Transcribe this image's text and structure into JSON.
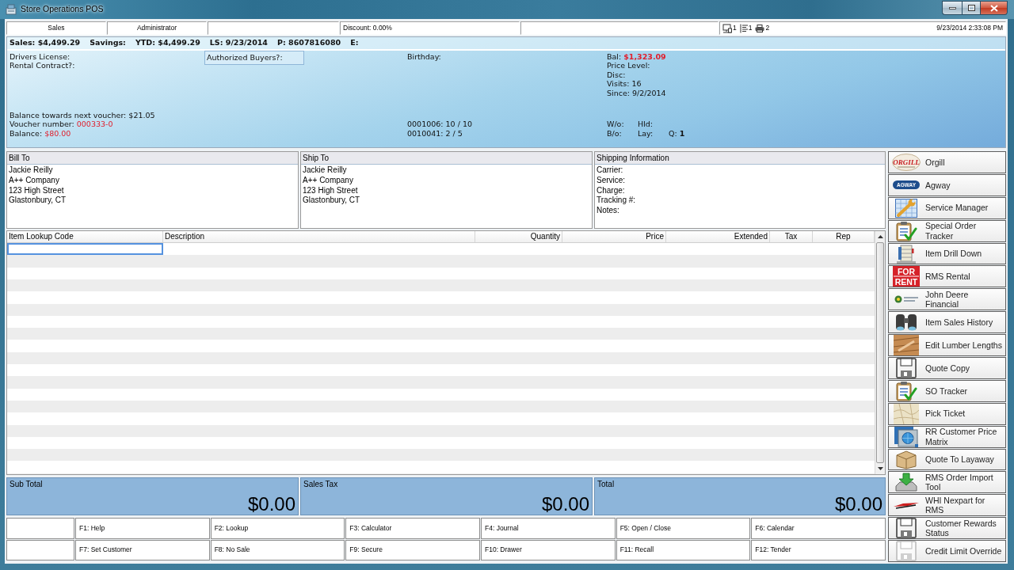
{
  "window": {
    "title": "Store Operations POS"
  },
  "status_strip": {
    "mode": "Sales",
    "user": "Administrator",
    "discount": "Discount: 0.00%",
    "counters": [
      {
        "kind": "register",
        "count": "1"
      },
      {
        "kind": "journal",
        "count": "1"
      },
      {
        "kind": "printer",
        "count": "2"
      }
    ],
    "datetime": "9/23/2014 2:33:08 PM"
  },
  "customer_info": {
    "summary": [
      "Sales: $4,499.29",
      "Savings:",
      "YTD: $4,499.29",
      "LS: 9/23/2014",
      "P: 8607816080",
      "E:"
    ],
    "columns": [
      {
        "framed": false,
        "top": [
          [
            {
              "kind": "plain",
              "label": "Drivers License:"
            }
          ],
          [
            {
              "kind": "plain",
              "label": "Rental Contract?:"
            }
          ]
        ],
        "bottom": [
          [
            {
              "kind": "plain",
              "label": "Balance towards next voucher:",
              "value": "$21.05"
            }
          ],
          [
            {
              "kind": "alert",
              "label": "Voucher number:",
              "value": "000333-0"
            }
          ],
          [
            {
              "kind": "alert",
              "label": "Balance:",
              "value": "$80.00"
            }
          ]
        ]
      },
      {
        "framed": true,
        "top": [
          [
            {
              "kind": "plain",
              "label": "Authorized Buyers?:"
            }
          ]
        ]
      },
      {
        "framed": false,
        "top": [
          [
            {
              "kind": "plain",
              "label": "Birthday:"
            }
          ]
        ],
        "bottom": [
          [
            {
              "kind": "plain",
              "label": "0001006:",
              "value": "10 / 10"
            }
          ],
          [
            {
              "kind": "plain",
              "label": "0010041:",
              "value": "2 / 5"
            }
          ]
        ]
      },
      {
        "framed": false,
        "top": [
          [
            {
              "kind": "critical",
              "label": "Bal:",
              "value": "$1,323.09"
            }
          ],
          [
            {
              "kind": "plain",
              "label": "Price Level:"
            }
          ],
          [
            {
              "kind": "plain",
              "label": "Disc:"
            }
          ],
          [
            {
              "kind": "plain",
              "label": "Visits:",
              "value": "16"
            }
          ],
          [
            {
              "kind": "plain",
              "label": "Since:",
              "value": "9/2/2014"
            }
          ]
        ],
        "bottom": [
          [
            {
              "kind": "plain",
              "label": "W/o:"
            },
            {
              "kind": "plain",
              "label": "Hld:"
            }
          ],
          [
            {
              "kind": "plain",
              "label": "B/o:"
            },
            {
              "kind": "plain",
              "label": "Lay:"
            },
            {
              "kind": "strong",
              "label": "Q:",
              "value": "1"
            }
          ]
        ]
      }
    ]
  },
  "address_panels": [
    {
      "title": "Bill To",
      "lines": [
        "Jackie Reilly",
        "A++ Company",
        "123 High Street",
        "Glastonbury, CT"
      ]
    },
    {
      "title": "Ship To",
      "lines": [
        "Jackie Reilly",
        "A++ Company",
        "123 High Street",
        "Glastonbury, CT"
      ]
    },
    {
      "title": "Shipping Information",
      "lines": [
        "Carrier:",
        "Service:",
        "Charge:",
        "Tracking #:",
        "Notes:"
      ]
    }
  ],
  "item_grid": {
    "columns": [
      "Item Lookup Code",
      "Description",
      "Quantity",
      "Price",
      "Extended",
      "Tax",
      "Rep"
    ],
    "entry": {
      "focused": true
    }
  },
  "totals": [
    {
      "label": "Sub Total",
      "amount": "$0.00"
    },
    {
      "label": "Sales Tax",
      "amount": "$0.00"
    },
    {
      "label": "Total",
      "amount": "$0.00"
    }
  ],
  "function_keys": [
    [
      "F1: Help",
      "F2: Lookup",
      "F3: Calculator",
      "F4: Journal",
      "F5: Open / Close",
      "F6: Calendar"
    ],
    [
      "F7: Set Customer",
      "F8: No Sale",
      "F9: Secure",
      "F10: Drawer",
      "F11: Recall",
      "F12: Tender"
    ]
  ],
  "side_buttons": [
    {
      "label": "Orgill",
      "kind": "oval",
      "logo_text": "ORGILL"
    },
    {
      "label": "Agway",
      "kind": "pill",
      "logo_text": "AGWAY"
    },
    {
      "label": "Service Manager",
      "kind": "wrench"
    },
    {
      "label": "Special Order Tracker",
      "kind": "clipboard"
    },
    {
      "label": "Item Drill Down",
      "kind": "cabinet"
    },
    {
      "label": "RMS Rental",
      "kind": "sign",
      "logo_text": "FOR RENT"
    },
    {
      "label": "John Deere Financial",
      "kind": "emblem"
    },
    {
      "label": "Item Sales History",
      "kind": "binoculars"
    },
    {
      "label": "Edit Lumber Lengths",
      "kind": "lumber"
    },
    {
      "label": "Quote Copy",
      "kind": "disk"
    },
    {
      "label": "SO Tracker",
      "kind": "clipboard"
    },
    {
      "label": "Pick Ticket",
      "kind": "map"
    },
    {
      "label": "RR Customer Price Matrix",
      "kind": "globe"
    },
    {
      "label": "Quote To Layaway",
      "kind": "carton"
    },
    {
      "label": "RMS Order Import Tool",
      "kind": "download"
    },
    {
      "label": "WHI Nexpart for RMS",
      "kind": "swoosh"
    },
    {
      "label": "Customer Rewards Status",
      "kind": "disk"
    },
    {
      "label": "Credit Limit Override",
      "kind": "ghostdisk"
    }
  ]
}
